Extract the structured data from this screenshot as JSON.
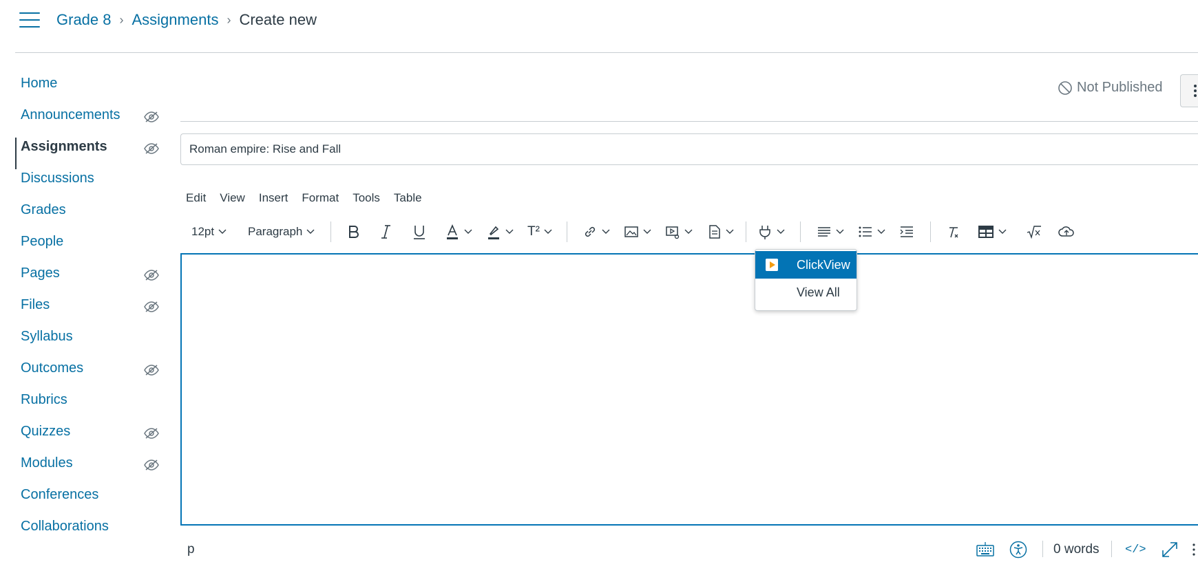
{
  "breadcrumbs": [
    {
      "label": "Grade 8"
    },
    {
      "label": "Assignments"
    },
    {
      "label": "Create new"
    }
  ],
  "sidebar": {
    "items": [
      {
        "label": "Home",
        "hidden": false
      },
      {
        "label": "Announcements",
        "hidden": true
      },
      {
        "label": "Assignments",
        "hidden": true,
        "active": true
      },
      {
        "label": "Discussions",
        "hidden": false
      },
      {
        "label": "Grades",
        "hidden": false
      },
      {
        "label": "People",
        "hidden": false
      },
      {
        "label": "Pages",
        "hidden": true
      },
      {
        "label": "Files",
        "hidden": true
      },
      {
        "label": "Syllabus",
        "hidden": false
      },
      {
        "label": "Outcomes",
        "hidden": true
      },
      {
        "label": "Rubrics",
        "hidden": false
      },
      {
        "label": "Quizzes",
        "hidden": true
      },
      {
        "label": "Modules",
        "hidden": true
      },
      {
        "label": "Conferences",
        "hidden": false
      },
      {
        "label": "Collaborations",
        "hidden": false
      }
    ]
  },
  "publish_status": "Not Published",
  "assignment": {
    "title_value": "Roman empire: Rise and Fall",
    "title_placeholder": ""
  },
  "editor": {
    "menubar": [
      "Edit",
      "View",
      "Insert",
      "Format",
      "Tools",
      "Table"
    ],
    "toolbar": {
      "font_size": "12pt",
      "block_format": "Paragraph",
      "superscript_label": "T²"
    },
    "plugins_dropdown": {
      "items": [
        {
          "label": "ClickView",
          "highlighted": true,
          "icon": "clickview-icon"
        },
        {
          "label": "View All",
          "highlighted": false
        }
      ]
    },
    "statusbar": {
      "element_path": "p",
      "word_count": "0 words",
      "html_toggle": "</>"
    }
  },
  "colors": {
    "link": "#0770a3",
    "accent": "#0374b5",
    "text": "#2d3b45",
    "muted": "#6b7780",
    "border": "#c7cdd1",
    "clickview_orange": "#f39c12"
  }
}
